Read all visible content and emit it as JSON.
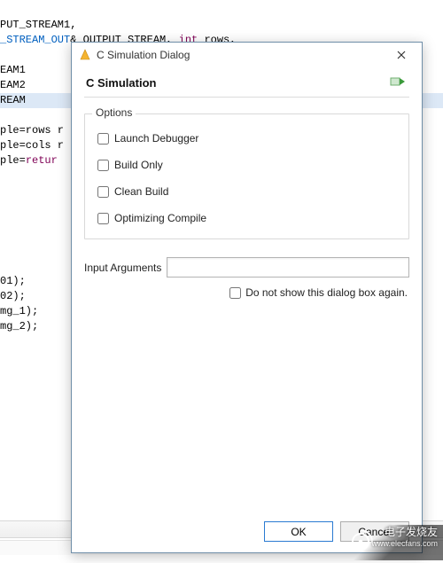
{
  "code": {
    "l1": "PUT_STREAM1,",
    "l2_a": "_STREAM_OUT",
    "l2_b": "& OUTPUT_STREAM, ",
    "l2_c": "int",
    "l2_d": " rows,",
    "l4": "EAM1",
    "l5": "EAM2",
    "l6": "REAM",
    "l8": "ple=rows r",
    "l9": "ple=cols r",
    "l10a": "ple=",
    "l10b": "retur",
    "l12": "01);",
    "l13": "02);",
    "l14": "mg_1);",
    "l15": "mg_2);"
  },
  "dialog": {
    "title": "C Simulation Dialog",
    "heading": "C Simulation",
    "options_legend": "Options",
    "opts": {
      "launch_debugger": "Launch Debugger",
      "build_only": "Build Only",
      "clean_build": "Clean Build",
      "optimizing_compile": "Optimizing Compile"
    },
    "input_arguments_label": "Input Arguments",
    "input_arguments_value": "",
    "dont_show": "Do not show this dialog box again.",
    "ok": "OK",
    "cancel": "Cancel"
  },
  "watermark": {
    "line1": "电子发烧友",
    "line2": "www.elecfans.com"
  }
}
